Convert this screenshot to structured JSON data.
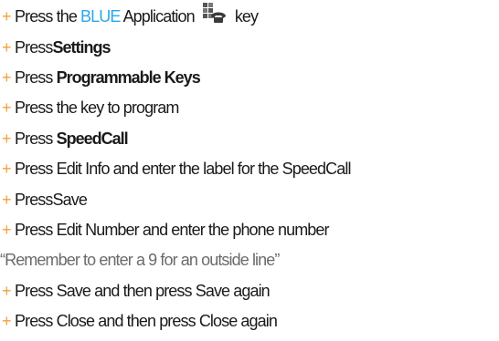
{
  "plus_glyph": "+",
  "steps": [
    {
      "pre": "Press the ",
      "blue": "BLUE",
      "post": " Application",
      "after_icon": " key",
      "icon": "phone-application-icon"
    },
    {
      "pre": "Press",
      "bold": "Settings"
    },
    {
      "pre": "Press ",
      "bold": "Programmable Keys"
    },
    {
      "text": "Press the key to program"
    },
    {
      "pre": "Press ",
      "bold": "SpeedCall"
    },
    {
      "text": "Press Edit Info and enter the label for  the SpeedCall"
    },
    {
      "text": "PressSave"
    },
    {
      "text": "Press Edit Number and enter the phone number"
    },
    {
      "note": "“Remember to enter a 9 for an outside line”"
    },
    {
      "text": "Press Save and then press Save again"
    },
    {
      "text": "Press Close and then press Close again"
    }
  ],
  "colors": {
    "plus": "#f0a23c",
    "blue_word": "#2aa8e8",
    "text": "#1a1a1a",
    "note": "#6b6b6b"
  }
}
